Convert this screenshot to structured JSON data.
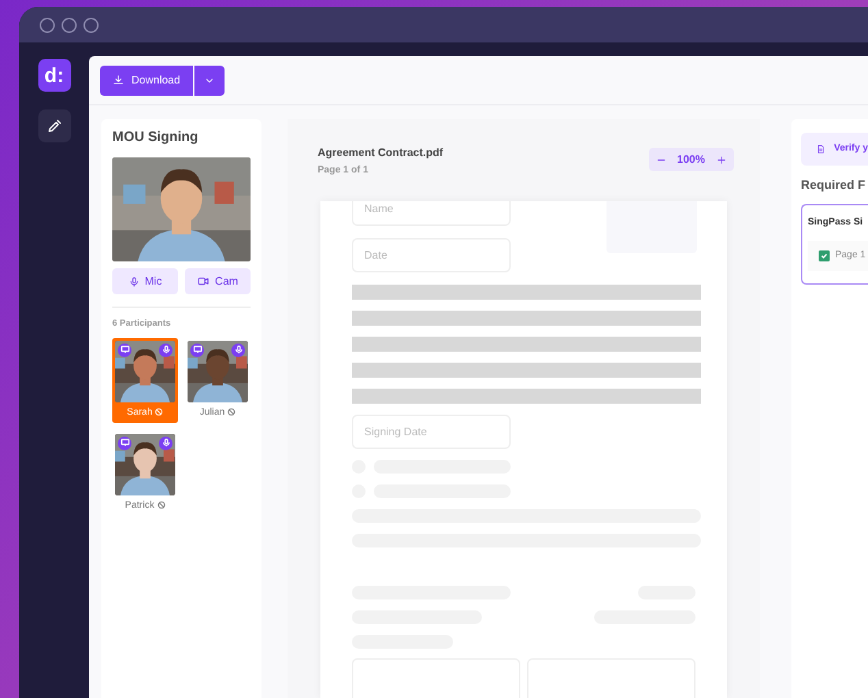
{
  "rail": {
    "logo": "d:",
    "tools": [
      {
        "kind": "pen",
        "selected": false
      }
    ]
  },
  "toolbar": {
    "download_button": "Download"
  },
  "meeting": {
    "title": "MOU Signing",
    "buttons": [
      {
        "kind": "mic",
        "label": "Mic"
      },
      {
        "kind": "cam",
        "label": "Cam"
      }
    ],
    "participants_count": "6 Participants",
    "participants": [
      {
        "name": "Sarah",
        "selected": true
      },
      {
        "name": "Julian",
        "selected": false
      },
      {
        "name": "Patrick",
        "selected": false
      }
    ]
  },
  "document": {
    "filename": "Agreement Contract.pdf",
    "page_info": "Page 1 of 1",
    "zoom": "100%",
    "fields": [
      {
        "placeholder": "Name"
      },
      {
        "placeholder": "Date"
      }
    ],
    "signing_field": {
      "placeholder": "Signing Date"
    }
  },
  "side_panel": {
    "verify_button": "Verify y",
    "section_title": "Required F",
    "card": {
      "title": "SingPass Si",
      "item": {
        "label": "Page 1",
        "checked": true
      }
    }
  }
}
